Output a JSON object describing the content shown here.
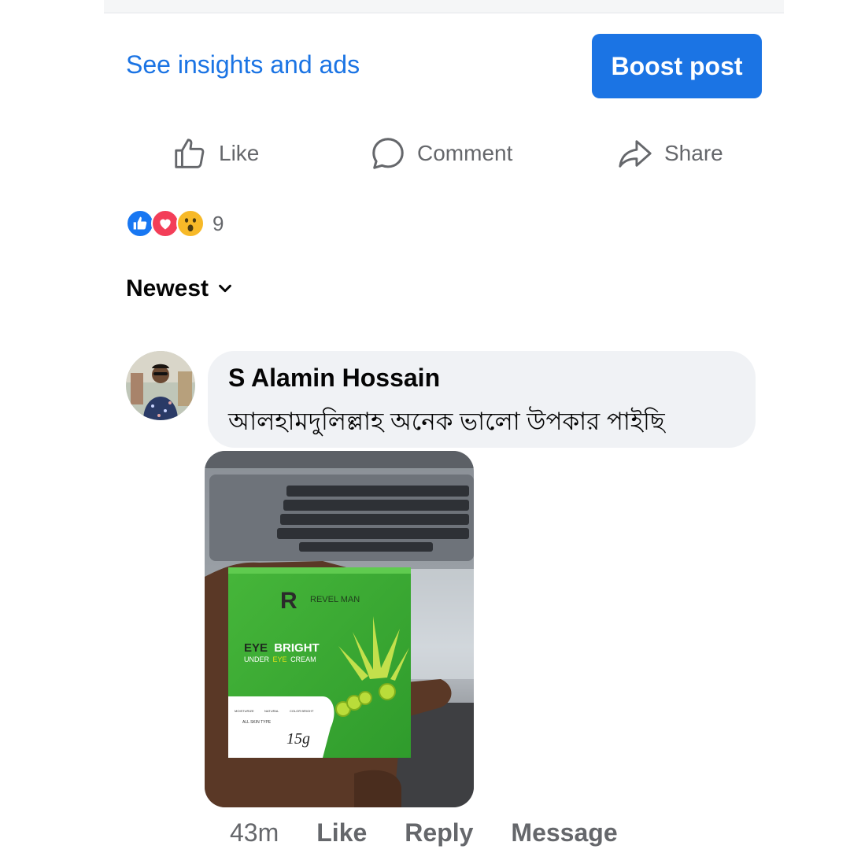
{
  "post": {
    "insights_link": "See insights and ads",
    "boost_button": "Boost post"
  },
  "actions": {
    "like": "Like",
    "comment": "Comment",
    "share": "Share"
  },
  "reactions": {
    "types": [
      "like",
      "love",
      "wow"
    ],
    "count": "9",
    "colors": {
      "like": "#1877f2",
      "love": "#f33e58",
      "wow": "#f7b928"
    }
  },
  "comments_sort": {
    "label": "Newest"
  },
  "comment": {
    "author": "S Alamin Hossain",
    "text": "আলহামদুলিল্লাহ অনেক ভালো উপকার পাইছি",
    "product": {
      "brand": "REVEL MAN",
      "name_part1": "EYE",
      "name_part2": "BRIGHT",
      "subtitle_part1": "UNDER",
      "subtitle_part2": "EYE",
      "subtitle_part3": "CREAM",
      "badges": [
        "MOISTURIZE",
        "NATURAL",
        "COLOR BRIGHT"
      ],
      "skin_type": "ALL SKIN TYPE",
      "weight": "15g"
    },
    "meta": {
      "time": "43m",
      "like": "Like",
      "reply": "Reply",
      "message": "Message"
    }
  },
  "colors": {
    "accent": "#1b74e4",
    "bubble": "#f0f2f5",
    "secondary_text": "#65676b"
  }
}
